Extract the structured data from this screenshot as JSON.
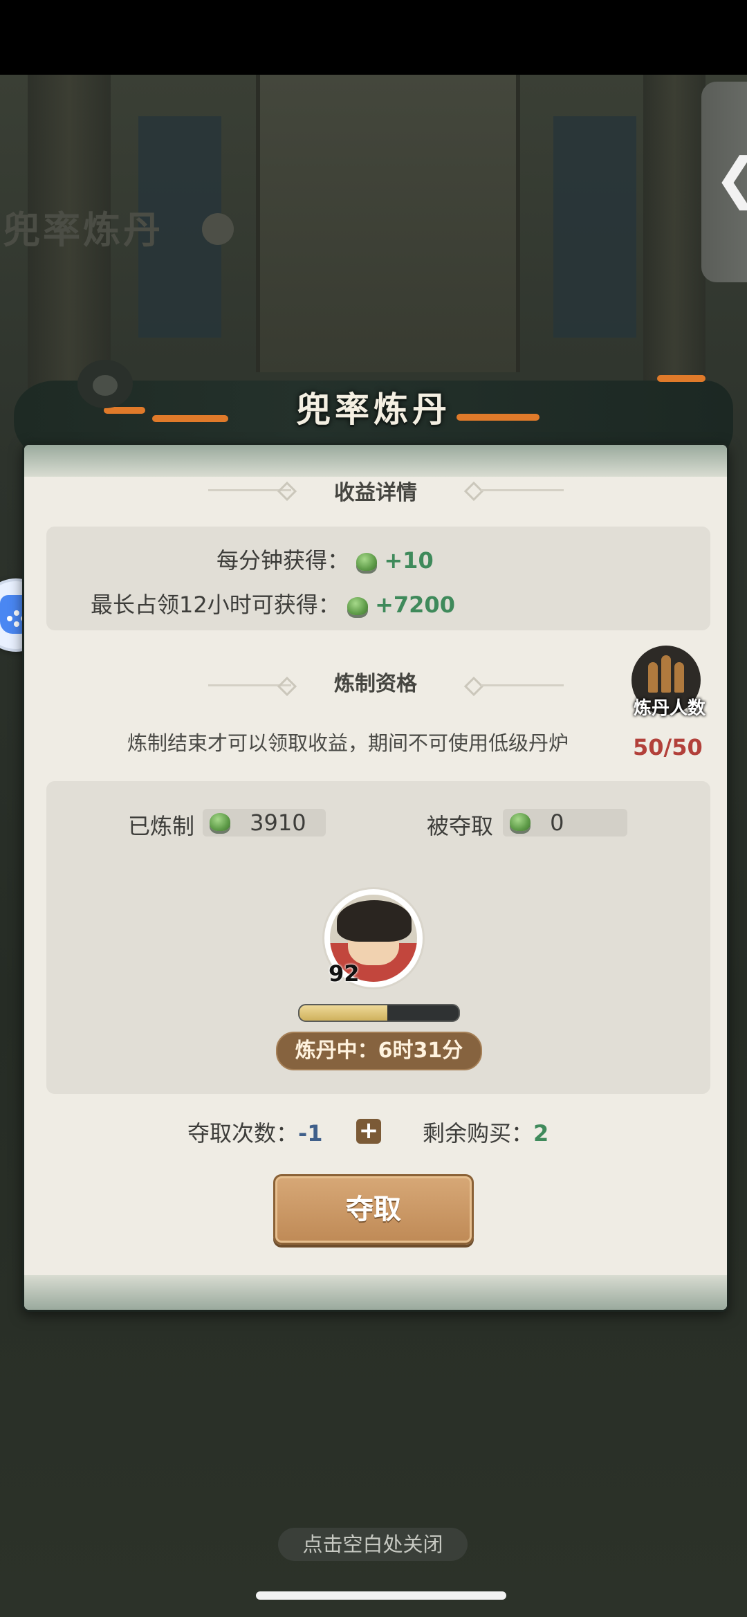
{
  "background": {
    "title": "兜率炼丹"
  },
  "dialog": {
    "title": "兜率炼丹",
    "income": {
      "section_title": "收益详情",
      "per_minute_label": "每分钟获得：",
      "per_minute_value": "+10",
      "max_label": "最长占领12小时可获得：",
      "max_value": "+7200"
    },
    "qualification": {
      "section_title": "炼制资格",
      "note": "炼制结束才可以领取收益，期间不可使用低级丹炉",
      "badge_label": "炼丹人数",
      "badge_count": "50/50"
    },
    "stats": {
      "refined_label": "已炼制",
      "refined_value": "3910",
      "robbed_label": "被夺取",
      "robbed_value": "0"
    },
    "player": {
      "level": "92",
      "progress": 0.55,
      "status": "炼丹中：6时31分"
    },
    "rob": {
      "count_label": "夺取次数：",
      "count_value": "-1",
      "plus": "+",
      "remaining_label": "剩余购买：",
      "remaining_value": "2",
      "button_label": "夺取"
    }
  },
  "side_tab": {
    "arrow": "❮"
  },
  "close_hint": "点击空白处关闭",
  "colors": {
    "accent_green": "#3f8a5b",
    "button_brown": "#bf8a56",
    "count_red": "#b2403a"
  }
}
